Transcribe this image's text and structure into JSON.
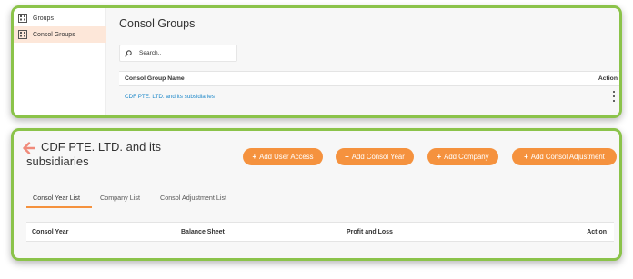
{
  "sidebar": {
    "items": [
      {
        "label": "Groups",
        "icon": "building-icon",
        "active": false
      },
      {
        "label": "Consol Groups",
        "icon": "building-icon",
        "active": true
      }
    ]
  },
  "consol_groups": {
    "title": "Consol Groups",
    "search": {
      "placeholder": "Search..",
      "value": ""
    },
    "table": {
      "columns": [
        "Consol Group Name",
        "Action"
      ],
      "rows": [
        {
          "name": "CDF PTE. LTD. and its subsidiaries"
        }
      ]
    }
  },
  "detail": {
    "title": "CDF PTE. LTD. and its subsidiaries",
    "buttons": {
      "add_user_access": "Add User Access",
      "add_consol_year": "Add Consol Year",
      "add_company": "Add Company",
      "add_consol_adjustment": "Add Consol Adjustment"
    },
    "tabs": [
      "Consol Year List",
      "Company List",
      "Consol Adjustment List"
    ],
    "active_tab": "Consol Year List",
    "table": {
      "columns": [
        "Consol Year",
        "Balance Sheet",
        "Profit and Loss",
        "Action"
      ]
    }
  },
  "colors": {
    "accent": "#f5923e",
    "link": "#1e88c9",
    "panel_border": "#8bc34a",
    "active_sidebar": "#fde7d9"
  }
}
